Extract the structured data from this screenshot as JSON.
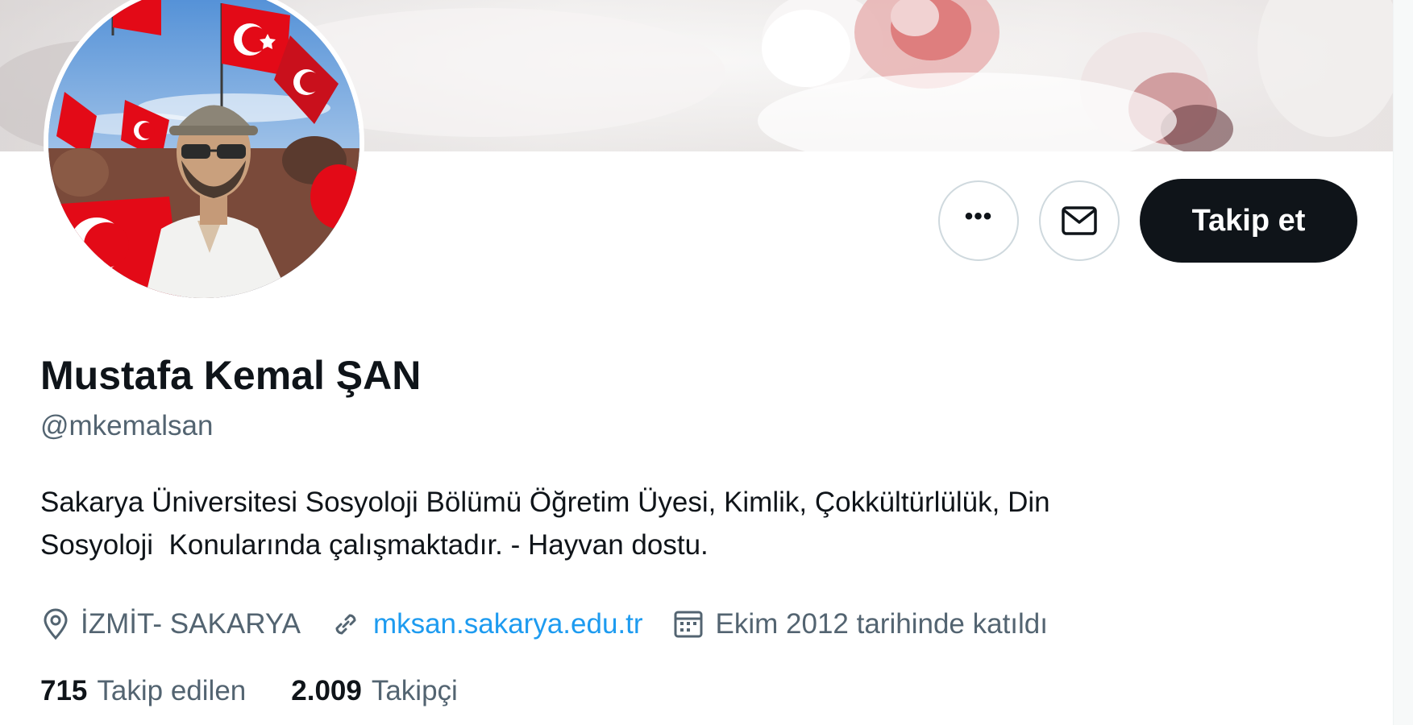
{
  "profile": {
    "name": "Mustafa Kemal ŞAN",
    "handle": "@mkemalsan",
    "bio_lines": [
      "Sakarya Üniversitesi Sosyoloji Bölümü Öğretim Üyesi, Kimlik, Çokkültürlülük, Din",
      "Sosyoloji  Konularında çalışmaktadır. - Hayvan dostu."
    ],
    "location": "İZMİT- SAKARYA",
    "website": "mksan.sakarya.edu.tr",
    "joined": "Ekim 2012 tarihinde katıldı",
    "following_count": "715",
    "following_label": "Takip edilen",
    "followers_count": "2.009",
    "followers_label": "Takipçi"
  },
  "actions": {
    "follow_label": "Takip et",
    "more_icon": "more-dots-icon",
    "message_icon": "envelope-icon"
  },
  "icons": {
    "location": "map-pin-icon",
    "link": "link-icon",
    "calendar": "calendar-icon"
  },
  "colors": {
    "text_primary": "#0f1419",
    "text_secondary": "#536471",
    "link": "#1d9bf0",
    "follow_button_bg": "#0f1419",
    "button_border": "#cfd9de",
    "flag_red": "#e30a17"
  }
}
